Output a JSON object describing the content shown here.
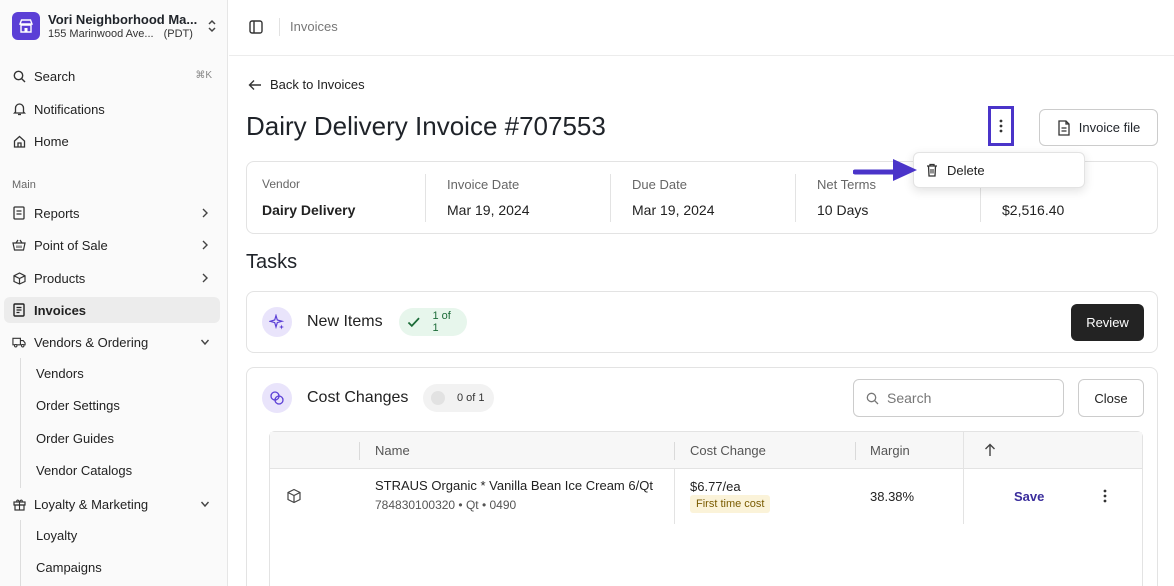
{
  "store": {
    "name": "Vori Neighborhood Ma...",
    "address": "155 Marinwood Ave...",
    "timezone": "(PDT)"
  },
  "sidebar": {
    "top": [
      {
        "label": "Search",
        "shortcut": "⌘K",
        "icon": "search-icon"
      },
      {
        "label": "Notifications",
        "icon": "bell-icon"
      },
      {
        "label": "Home",
        "icon": "home-icon"
      }
    ],
    "section_label": "Main",
    "main": [
      {
        "label": "Reports",
        "icon": "report-icon",
        "expandable": true
      },
      {
        "label": "Point of Sale",
        "icon": "basket-icon",
        "expandable": true
      },
      {
        "label": "Products",
        "icon": "box-icon",
        "expandable": true
      },
      {
        "label": "Invoices",
        "icon": "invoice-icon",
        "active": true
      },
      {
        "label": "Vendors & Ordering",
        "icon": "truck-icon",
        "expanded": true
      }
    ],
    "vendors_sub": [
      "Vendors",
      "Order Settings",
      "Order Guides",
      "Vendor Catalogs"
    ],
    "loyalty": {
      "label": "Loyalty & Marketing",
      "icon": "gift-icon",
      "expanded": true
    },
    "loyalty_sub": [
      "Loyalty",
      "Campaigns"
    ]
  },
  "topbar": {
    "breadcrumb": "Invoices"
  },
  "page": {
    "back_label": "Back to Invoices",
    "title": "Dairy Delivery Invoice #707553",
    "file_button": "Invoice file"
  },
  "summary": [
    {
      "label": "Vendor",
      "value": "Dairy Delivery"
    },
    {
      "label": "Invoice Date",
      "value": "Mar 19, 2024"
    },
    {
      "label": "Due Date",
      "value": "Mar 19, 2024"
    },
    {
      "label": "Net Terms",
      "value": "10 Days"
    },
    {
      "label": "",
      "value": "$2,516.40"
    }
  ],
  "menu": {
    "delete_label": "Delete"
  },
  "tasks": {
    "title": "Tasks",
    "new_items": {
      "label": "New Items",
      "progress": "1 of 1",
      "button": "Review"
    },
    "cost_changes": {
      "label": "Cost Changes",
      "progress": "0 of 1",
      "search_placeholder": "Search",
      "close_button": "Close",
      "columns": {
        "name": "Name",
        "cost_change": "Cost Change",
        "margin": "Margin"
      },
      "rows": [
        {
          "name": "STRAUS Organic * Vanilla Bean Ice Cream 6/Qt",
          "meta": "784830100320 • Qt • 0490",
          "cost": "$6.77/ea",
          "badge": "First time cost",
          "margin": "38.38%",
          "action": "Save"
        }
      ]
    }
  },
  "colors": {
    "accent": "#4a34c9",
    "dark_button": "#232323",
    "success_bg": "#e7f6ec"
  }
}
